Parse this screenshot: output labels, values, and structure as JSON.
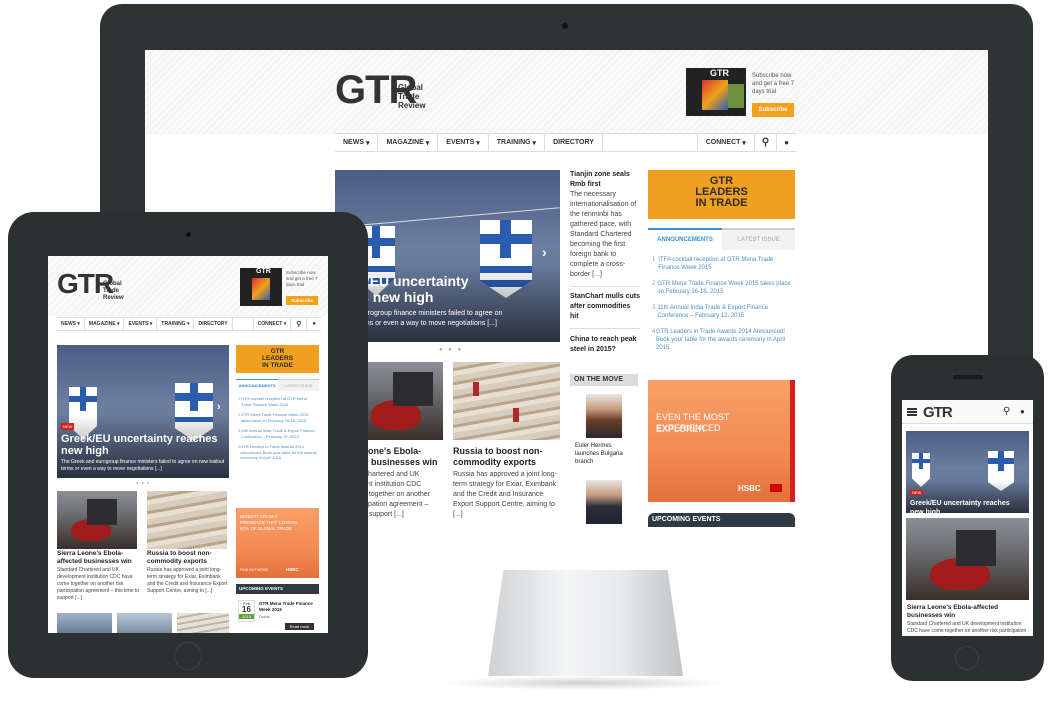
{
  "brand": {
    "logo": "GTR",
    "logo_sub_1": "Global",
    "logo_sub_2": "Trade",
    "logo_sub_3": "Review",
    "subscribe_text": "Subscribe now and get a free 7 days trial",
    "subscribe_button": "Subscribe",
    "accent": "#f0a21c"
  },
  "nav": {
    "items": [
      "NEWS",
      "MAGAZINE",
      "EVENTS",
      "TRAINING",
      "DIRECTORY"
    ],
    "connect": "CONNECT",
    "search_icon": "search-icon",
    "user_icon": "user-icon"
  },
  "hero": {
    "headline_full": "Greek/EU uncertainty reaches new high",
    "headline_desktop_1": "reek/EU uncertainty",
    "headline_desktop_2": "ches new high",
    "summary_tablet": "The Greek and eurogroup finance ministers failed to agree on new bailout terms or even a way to move negotiations [...]",
    "summary_desktop_1": "ek and eurogroup finance ministers failed to agree on",
    "summary_desktop_2": "ailout terms or even a way to move negotiations [...]",
    "badge": "NEW"
  },
  "stories": [
    {
      "title": "Sierra Leone's Ebola-affected businesses win",
      "title_desktop_1": "eone's Ebola-",
      "title_desktop_2": "d businesses win",
      "summary": "Standard Chartered and UK development institution CDC have come together on another risk participation agreement – this time to support [...]",
      "summary_desktop_1": "Chartered and UK",
      "summary_desktop_2": "ent institution CDC",
      "summary_desktop_3": "e together on another",
      "summary_desktop_4": "cipation agreement –",
      "summary_desktop_5": "o support [...]"
    },
    {
      "title": "Russia to boost non-commodity exports",
      "summary": "Russia has approved a joint long-term strategy for Exiar, Eximbank and the Credit and Insurance Export Support Centre, aiming to [...]"
    }
  ],
  "side_stories": [
    {
      "title": "Tianjin zone seals Rmb first",
      "summary": "The necessary internationalisation of the renminbi has gathered pace, with Standard Chartered becoming the first foreign bank to complete a cross-border [...]"
    },
    {
      "title": "StanChart mulls cuts after commodities hit"
    },
    {
      "title": "China to reach peak steel in 2015?"
    }
  ],
  "on_the_move": {
    "heading": "ON THE MOVE",
    "item_1": "Euler Hermes launches Bulgaria branch"
  },
  "leaders": {
    "line1": "GTR",
    "line2": "LEADERS",
    "line3": "IN TRADE"
  },
  "tabs": {
    "active": "ANNOUNCEMENTS",
    "inactive": "LATEST ISSUE"
  },
  "announcements": [
    "ITFA cocktail reception at GTR Mena Trade Finance Week 2015",
    "GTR Mena Trade Finance Week 2015 takes place on February 16-18, 2015",
    "11th Annual India Trade & Export Finance Conference – February 12, 2015",
    "GTR Leaders in Trade Awards 2014 Announced! Book your table for the awards ceremony in April 2015."
  ],
  "hsbc_ad": {
    "line1": "EVEN THE MOST EXPERIENCED",
    "line2": "EXPLORER",
    "brand": "HSBC",
    "tablet_line": "BENEFIT FROM A PRESENCE THAT COVERS 87% OF GLOBAL TRADE",
    "tablet_cta": "FIND OUT MORE"
  },
  "events": {
    "heading": "UPCOMING EVENTS",
    "month": "Feb",
    "day": "16",
    "year": "2015",
    "title": "GTR Mena Trade Finance Week 2015",
    "location": "Dubai",
    "read_more": "Read more"
  },
  "counts": {
    "desktop_markers": 2
  }
}
